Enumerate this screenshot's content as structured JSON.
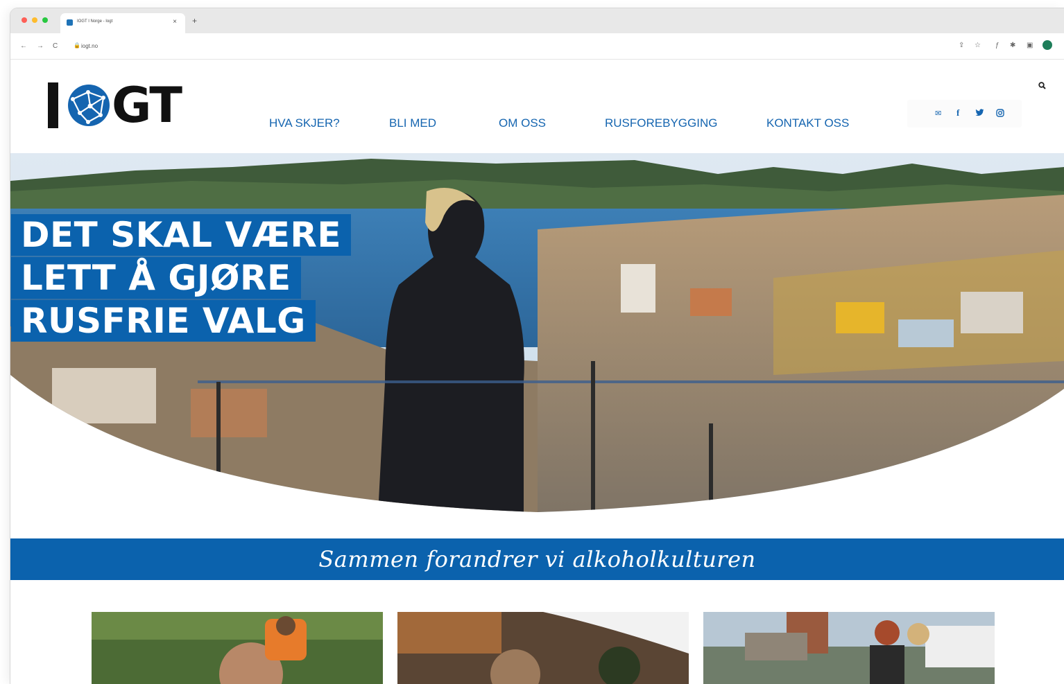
{
  "browser": {
    "tab_title": "IOGT I Norge - Iogt",
    "tab_close": "×",
    "new_tab": "+",
    "url": "iogt.no",
    "back": "←",
    "forward": "→",
    "reload": "C"
  },
  "site": {
    "logo_text": "IOGT",
    "logo_gt": "GT",
    "nav": [
      "HVA SKJER?",
      "BLI MED",
      "OM OSS",
      "RUSFOREBYGGING",
      "KONTAKT OSS"
    ],
    "social_icons": [
      "email-icon",
      "facebook-icon",
      "twitter-icon",
      "instagram-icon"
    ],
    "search_icon": "search-icon"
  },
  "hero": {
    "headline": [
      "DET SKAL VÆRE",
      "LETT Å GJØRE",
      "RUSFRIE VALG"
    ]
  },
  "tagline": "Sammen forandrer vi alkoholkulturen",
  "colors": {
    "brand_blue": "#0b62ad",
    "nav_blue": "#1565b0",
    "logo_black": "#111111"
  }
}
